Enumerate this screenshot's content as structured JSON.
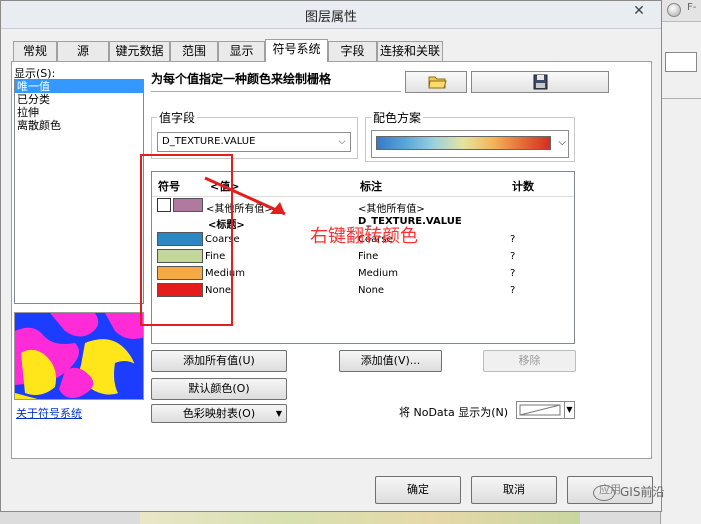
{
  "window": {
    "title": "图层属性",
    "close": "✕"
  },
  "background_right": {
    "text": "F-"
  },
  "tabs": [
    "常规",
    "源",
    "键元数据",
    "范围",
    "显示",
    "符号系统",
    "字段",
    "连接和关联"
  ],
  "active_tab": "符号系统",
  "show_panel": {
    "label": "显示(S):",
    "items": [
      "唯一值",
      "已分类",
      "拉伸",
      "离散颜色"
    ],
    "selected": "唯一值"
  },
  "about_link": "关于符号系统",
  "heading": "为每个值指定一种颜色来绘制栅格",
  "toolbar": {
    "open_icon": "open-folder-icon",
    "save_icon": "save-disk-icon"
  },
  "value_field": {
    "label": "值字段",
    "value": "D_TEXTURE.VALUE"
  },
  "color_scheme": {
    "label": "配色方案"
  },
  "table": {
    "headers": {
      "symbol": "符号",
      "value": "<值>",
      "label": "标注",
      "count": "计数"
    },
    "rows": [
      {
        "swatch": "#b07aa0",
        "value": "<其他所有值>",
        "label": "<其他所有值>",
        "count": ""
      },
      {
        "swatch": "",
        "value": "<标题>",
        "label": "D_TEXTURE.VALUE",
        "count": ""
      },
      {
        "swatch": "#2e86c1",
        "value": "Coarse",
        "label": "Coarse",
        "count": "?"
      },
      {
        "swatch": "#c4d79b",
        "value": "Fine",
        "label": "Fine",
        "count": "?"
      },
      {
        "swatch": "#f6a945",
        "value": "Medium",
        "label": "Medium",
        "count": "?"
      },
      {
        "swatch": "#e61c1c",
        "value": "None",
        "label": "None",
        "count": "?"
      }
    ]
  },
  "buttons": {
    "add_all": "添加所有值(U)",
    "add_values": "添加值(V)...",
    "remove": "移除",
    "default_colors": "默认颜色(O)",
    "colormap": "色彩映射表(O)",
    "ok": "确定",
    "cancel": "取消",
    "apply": "应用"
  },
  "nodata": {
    "label": "将 NoData 显示为(N)"
  },
  "annotation": "右键翻转颜色",
  "watermark": "GIS前沿",
  "colors": {
    "highlight": "#e21e1e",
    "selection": "#3399ff",
    "link": "#0033cc"
  }
}
